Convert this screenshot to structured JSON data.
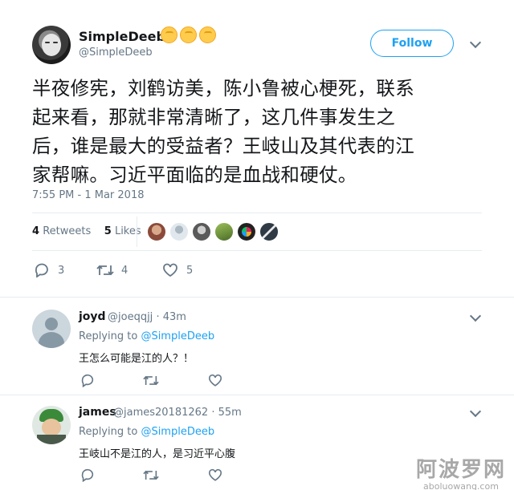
{
  "tweet": {
    "display_name": "SimpleDeeb",
    "handle": "@SimpleDeeb",
    "follow_label": "Follow",
    "text": "半夜修宪，刘鹤访美，陈小鲁被心梗死，联系起来看，那就非常清晰了，这几件事发生之后，谁是最大的受益者？王岐山及其代表的江家帮嘛。习近平面临的是血战和硬仗。",
    "text_lines": [
      "半夜修宪，刘鹤访美，陈小鲁被心梗死，联系",
      "起来看，那就非常清晰了，这几件事发生之",
      "后，谁是最大的受益者？王岐山及其代表的江",
      "家帮嘛。习近平面临的是血战和硬仗。"
    ],
    "timestamp": "7:55 PM - 1 Mar 2018",
    "retweets_count": "4",
    "retweets_label": "Retweets",
    "likes_count": "5",
    "likes_label": "Likes",
    "reply_count": "3",
    "retweet_action_count": "4",
    "like_action_count": "5",
    "name_emoji_icons": [
      "raised-fist-icon",
      "raised-fist-icon",
      "raised-fist-icon"
    ],
    "liker_avatar_colors": [
      "#8b4a3a",
      "#9aa5b1",
      "#5a5a5a",
      "#6b8e3a",
      "#222222",
      "#2f3a45"
    ]
  },
  "replies": [
    {
      "name": "joyd",
      "handle": "@joeqqjj",
      "time": "· 43m",
      "replying_prefix": "Replying to",
      "replying_to": "@SimpleDeeb",
      "text": "王怎么可能是江的人？！"
    },
    {
      "name": "james",
      "handle": "@james20181262",
      "time": "· 55m",
      "replying_prefix": "Replying to",
      "replying_to": "@SimpleDeeb",
      "text": "王岐山不是江的人，是习近平心腹"
    }
  ],
  "watermark": {
    "cn": "阿波罗网",
    "en": "aboluowang.com"
  },
  "colors": {
    "accent": "#1da1f2",
    "muted": "#657786",
    "text": "#14171a",
    "divider": "#e6ecf0"
  }
}
